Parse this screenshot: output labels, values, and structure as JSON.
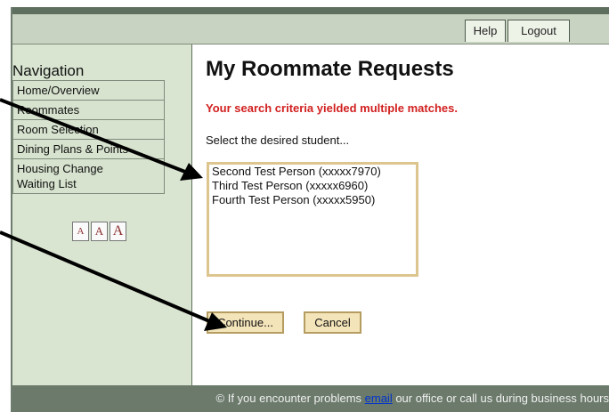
{
  "topbar": {
    "help_label": "Help",
    "logout_label": "Logout"
  },
  "sidebar": {
    "title": "Navigation",
    "items": [
      {
        "label": "Home/Overview"
      },
      {
        "label": "Roommates"
      },
      {
        "label": "Room Selection"
      },
      {
        "label": "Dining Plans & Points"
      },
      {
        "label": "Housing Change\nWaiting List"
      }
    ],
    "font_sizes": [
      "A",
      "A",
      "A"
    ]
  },
  "main": {
    "title": "My Roommate Requests",
    "alert": "Your search criteria yielded multiple matches.",
    "prompt": "Select the desired student...",
    "students": [
      "Second Test Person (xxxxx7970)",
      "Third Test Person (xxxxx6960)",
      "Fourth Test Person (xxxxx5950)"
    ],
    "continue_label": "Continue...",
    "cancel_label": "Cancel"
  },
  "footer": {
    "prefix": "© If you encounter problems ",
    "link": "email",
    "suffix": " our office or call us during business hours"
  },
  "colors": {
    "sidebar_bg": "#d9e5d1",
    "topbar_bg": "#c9d3c1",
    "footer_bg": "#6b7a6b",
    "alert": "#d22020",
    "button_border": "#b59d62",
    "button_bg": "#f4e4ba"
  }
}
